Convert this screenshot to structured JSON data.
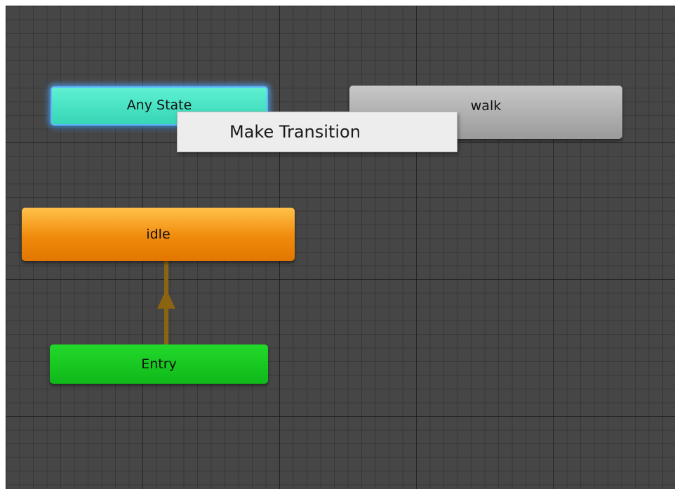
{
  "graph": {
    "states": {
      "any_state": {
        "label": "Any State",
        "color": "#4de8c8",
        "selected": true
      },
      "walk": {
        "label": "walk",
        "color": "#b4b4b4"
      },
      "idle": {
        "label": "idle",
        "color": "#f28a0c",
        "default_state": true
      },
      "entry": {
        "label": "Entry",
        "color": "#17c622"
      }
    },
    "transitions": [
      {
        "from": "Entry",
        "to": "idle",
        "color": "#8a6410"
      }
    ]
  },
  "context_menu": {
    "items": [
      {
        "label": "Make Transition"
      }
    ]
  },
  "colors": {
    "canvas_background": "#464646",
    "selection_glow": "#5fb6ff"
  }
}
